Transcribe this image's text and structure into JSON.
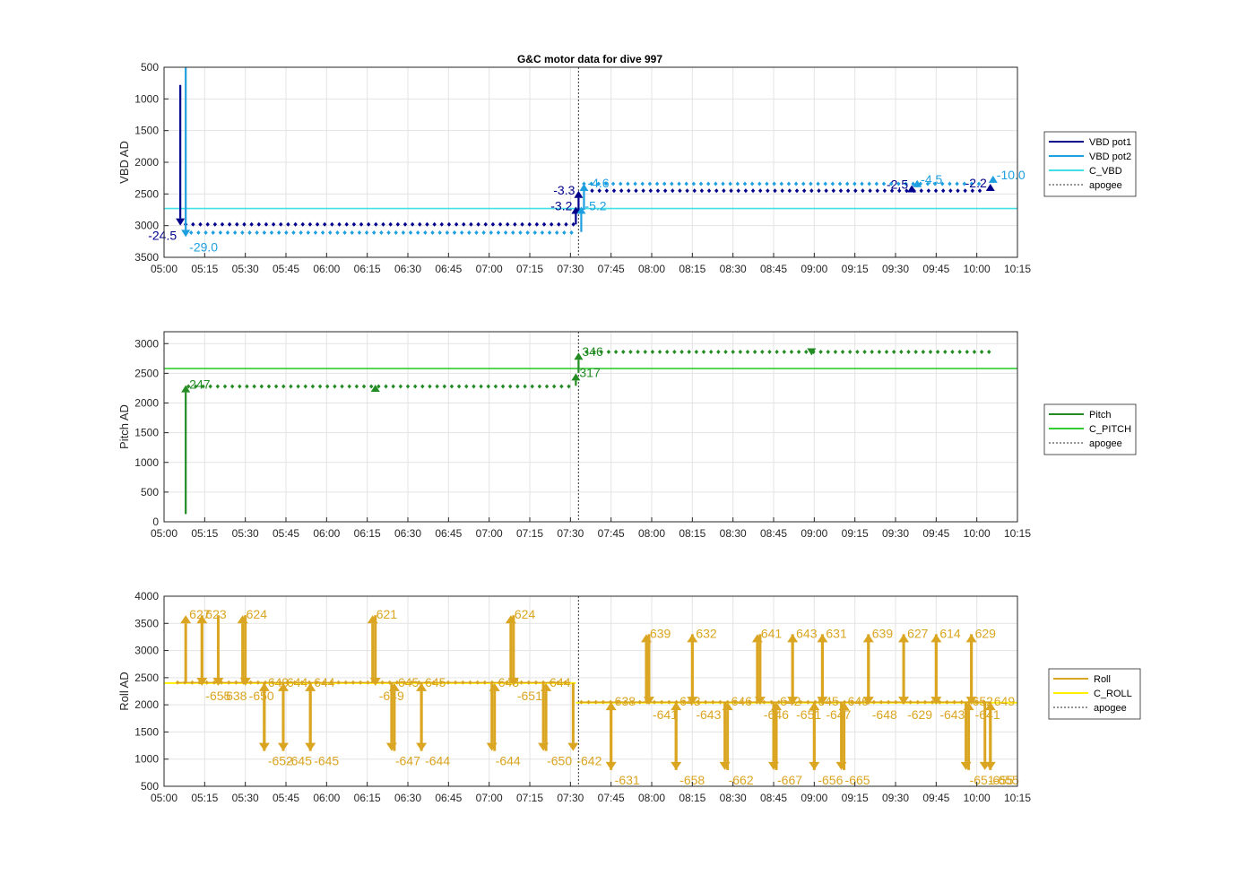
{
  "figure_title": "G&C motor data for dive 997",
  "x_ticks": [
    "05:00",
    "05:15",
    "05:30",
    "05:45",
    "06:00",
    "06:15",
    "06:30",
    "06:45",
    "07:00",
    "07:15",
    "07:30",
    "07:45",
    "08:00",
    "08:15",
    "08:30",
    "08:45",
    "09:00",
    "09:15",
    "09:30",
    "09:45",
    "10:00",
    "10:15"
  ],
  "colors": {
    "vbd_pot1": "#00008B",
    "vbd_pot2": "#1E9FE0",
    "c_vbd": "#40E0E6",
    "pitch": "#228B22",
    "c_pitch": "#32CD32",
    "roll": "#DAA520",
    "c_roll": "#FFF000",
    "apogee": "#555555"
  },
  "chart_data": [
    {
      "type": "line",
      "title": "G&C motor data for dive 997",
      "xlabel": "",
      "ylabel": "VBD AD",
      "x_unit": "HH:MM",
      "xlim": [
        "05:00",
        "10:15"
      ],
      "ylim": [
        3500,
        500
      ],
      "y_reversed": true,
      "yticks": [
        500,
        1000,
        1500,
        2000,
        2500,
        3000,
        3500
      ],
      "grid": true,
      "legend_position": "right",
      "legend": [
        "VBD pot1",
        "VBD pot2",
        "C_VBD",
        "apogee"
      ],
      "apogee": "07:33",
      "c_value": 2730,
      "series": [
        {
          "name": "VBD pot1",
          "color": "vbd_pot1",
          "samples": {
            "from": "05:08",
            "to": "07:32",
            "y": 2980
          },
          "samples2": {
            "from": "07:38",
            "to": "10:03",
            "y": 2450
          }
        },
        {
          "name": "VBD pot2",
          "color": "vbd_pot2",
          "samples": {
            "from": "05:10",
            "to": "07:32",
            "y": 3110
          },
          "samples2": {
            "from": "07:35",
            "to": "10:03",
            "y": 2340
          }
        }
      ],
      "annotations": [
        {
          "x": "05:06",
          "y0": 780,
          "y1": 3000,
          "dir": "down",
          "text": "-24.5",
          "color": "vbd_pot1",
          "side": "left"
        },
        {
          "x": "05:08",
          "y0": 500,
          "y1": 3180,
          "dir": "down",
          "text": "-29.0",
          "color": "vbd_pot2",
          "side": "right"
        },
        {
          "x": "07:32",
          "y0": 2980,
          "y1": 2700,
          "dir": "up",
          "text": "-3.2",
          "color": "vbd_pot1",
          "side": "left"
        },
        {
          "x": "07:33",
          "y0": 2780,
          "y1": 2450,
          "dir": "up",
          "text": "-3.3",
          "color": "vbd_pot1",
          "side": "left"
        },
        {
          "x": "07:34",
          "y0": 3100,
          "y1": 2700,
          "dir": "up",
          "text": "-5.2",
          "color": "vbd_pot2",
          "side": "right"
        },
        {
          "x": "07:35",
          "y0": 2750,
          "y1": 2340,
          "dir": "up",
          "text": "-4.6",
          "color": "vbd_pot2",
          "side": "right"
        },
        {
          "x": "09:36",
          "y0": 2450,
          "y1": 2360,
          "dir": "up",
          "text": "-2.5",
          "color": "vbd_pot1",
          "side": "left"
        },
        {
          "x": "09:38",
          "y0": 2350,
          "y1": 2280,
          "dir": "up",
          "text": "-4.5",
          "color": "vbd_pot2",
          "side": "right"
        },
        {
          "x": "10:05",
          "y0": 2420,
          "y1": 2340,
          "dir": "up",
          "text": "-2.2",
          "color": "vbd_pot1",
          "side": "left"
        },
        {
          "x": "10:06",
          "y0": 2300,
          "y1": 2210,
          "dir": "up",
          "text": "-10.0",
          "color": "vbd_pot2",
          "side": "right"
        }
      ]
    },
    {
      "type": "line",
      "title": "",
      "xlabel": "",
      "ylabel": "Pitch AD",
      "x_unit": "HH:MM",
      "xlim": [
        "05:00",
        "10:15"
      ],
      "ylim": [
        0,
        3200
      ],
      "yticks": [
        0,
        500,
        1000,
        1500,
        2000,
        2500,
        3000
      ],
      "grid": true,
      "legend_position": "right",
      "legend": [
        "Pitch",
        "C_PITCH",
        "apogee"
      ],
      "apogee": "07:33",
      "c_value": 2580,
      "series": [
        {
          "name": "Pitch",
          "color": "pitch",
          "samples": {
            "from": "05:09",
            "to": "07:30",
            "y": 2280
          },
          "samples2": {
            "from": "07:36",
            "to": "10:05",
            "y": 2860
          }
        }
      ],
      "annotations": [
        {
          "x": "05:08",
          "y0": 130,
          "y1": 2300,
          "dir": "up",
          "text": "247",
          "color": "pitch",
          "side": "right"
        },
        {
          "x": "06:18",
          "y0": 2260,
          "y1": 2310,
          "dir": "up",
          "text": "",
          "color": "pitch",
          "side": "right"
        },
        {
          "x": "07:32",
          "y0": 2290,
          "y1": 2500,
          "dir": "up",
          "text": "317",
          "color": "pitch",
          "side": "right"
        },
        {
          "x": "07:33",
          "y0": 2510,
          "y1": 2850,
          "dir": "up",
          "text": "346",
          "color": "pitch",
          "side": "right"
        },
        {
          "x": "08:59",
          "y0": 2880,
          "y1": 2800,
          "dir": "down",
          "text": "",
          "color": "pitch",
          "side": "right"
        }
      ]
    },
    {
      "type": "line",
      "title": "",
      "xlabel": "",
      "ylabel": "Roll AD",
      "x_unit": "HH:MM",
      "xlim": [
        "05:00",
        "10:15"
      ],
      "ylim": [
        500,
        4000
      ],
      "yticks": [
        500,
        1000,
        1500,
        2000,
        2500,
        3000,
        3500,
        4000
      ],
      "grid": true,
      "legend_position": "right",
      "legend": [
        "Roll",
        "C_ROLL",
        "apogee"
      ],
      "apogee": "07:33",
      "c_roll": [
        {
          "from": "05:00",
          "to": "07:32",
          "y": 2400
        },
        {
          "from": "07:32",
          "to": "10:15",
          "y": 2040
        }
      ],
      "series": [
        {
          "name": "Roll",
          "color": "roll",
          "samples": {
            "from": "05:05",
            "to": "07:30",
            "y": 2410
          },
          "samples2": {
            "from": "07:34",
            "to": "10:05",
            "y": 2050
          }
        }
      ],
      "annotations": [
        {
          "x": "05:08",
          "y0": 2400,
          "y1": 3650,
          "dir": "up",
          "text": "627",
          "color": "roll",
          "side": "right"
        },
        {
          "x": "05:14",
          "y0": 3650,
          "y1": 2350,
          "dir": "down",
          "text": "-655",
          "color": "roll",
          "side": "right"
        },
        {
          "x": "05:14",
          "y0": 2400,
          "y1": 3650,
          "dir": "up",
          "text": "623",
          "color": "roll",
          "side": "right"
        },
        {
          "x": "05:20",
          "y0": 3650,
          "y1": 2350,
          "dir": "down",
          "text": "-638",
          "color": "roll",
          "side": "right"
        },
        {
          "x": "05:29",
          "y0": 2400,
          "y1": 3650,
          "dir": "up",
          "text": "624",
          "color": "roll",
          "side": "right"
        },
        {
          "x": "05:30",
          "y0": 3650,
          "y1": 2350,
          "dir": "down",
          "text": "-650",
          "color": "roll",
          "side": "right"
        },
        {
          "x": "05:37",
          "y0": 2400,
          "y1": 1150,
          "dir": "down",
          "text": "-652",
          "color": "roll",
          "side": "right"
        },
        {
          "x": "05:37",
          "y0": 1150,
          "y1": 2400,
          "dir": "up",
          "text": "649",
          "color": "roll",
          "side": "right"
        },
        {
          "x": "05:44",
          "y0": 2400,
          "y1": 1150,
          "dir": "down",
          "text": "-645",
          "color": "roll",
          "side": "right"
        },
        {
          "x": "05:44",
          "y0": 1150,
          "y1": 2400,
          "dir": "up",
          "text": "644",
          "color": "roll",
          "side": "right"
        },
        {
          "x": "05:54",
          "y0": 2400,
          "y1": 1150,
          "dir": "down",
          "text": "-645",
          "color": "roll",
          "side": "right"
        },
        {
          "x": "05:54",
          "y0": 1150,
          "y1": 2400,
          "dir": "up",
          "text": "644",
          "color": "roll",
          "side": "right"
        },
        {
          "x": "06:17",
          "y0": 2400,
          "y1": 3650,
          "dir": "up",
          "text": "621",
          "color": "roll",
          "side": "right"
        },
        {
          "x": "06:18",
          "y0": 3650,
          "y1": 2350,
          "dir": "down",
          "text": "-649",
          "color": "roll",
          "side": "right"
        },
        {
          "x": "06:24",
          "y0": 2400,
          "y1": 1150,
          "dir": "down",
          "text": "-647",
          "color": "roll",
          "side": "right"
        },
        {
          "x": "06:25",
          "y0": 1150,
          "y1": 2400,
          "dir": "up",
          "text": "645",
          "color": "roll",
          "side": "right"
        },
        {
          "x": "06:35",
          "y0": 2400,
          "y1": 1150,
          "dir": "down",
          "text": "-644",
          "color": "roll",
          "side": "right"
        },
        {
          "x": "06:35",
          "y0": 1150,
          "y1": 2400,
          "dir": "up",
          "text": "645",
          "color": "roll",
          "side": "right"
        },
        {
          "x": "07:01",
          "y0": 2400,
          "y1": 1150,
          "dir": "down",
          "text": "-644",
          "color": "roll",
          "side": "right"
        },
        {
          "x": "07:02",
          "y0": 1150,
          "y1": 2400,
          "dir": "up",
          "text": "643",
          "color": "roll",
          "side": "right"
        },
        {
          "x": "07:08",
          "y0": 2400,
          "y1": 3650,
          "dir": "up",
          "text": "624",
          "color": "roll",
          "side": "right"
        },
        {
          "x": "07:09",
          "y0": 3650,
          "y1": 2350,
          "dir": "down",
          "text": "-651",
          "color": "roll",
          "side": "right"
        },
        {
          "x": "07:20",
          "y0": 2400,
          "y1": 1150,
          "dir": "down",
          "text": "-650",
          "color": "roll",
          "side": "right"
        },
        {
          "x": "07:21",
          "y0": 1150,
          "y1": 2400,
          "dir": "up",
          "text": "644",
          "color": "roll",
          "side": "right"
        },
        {
          "x": "07:31",
          "y0": 2400,
          "y1": 1150,
          "dir": "down",
          "text": "-642",
          "color": "roll",
          "side": "right"
        },
        {
          "x": "07:45",
          "y0": 2050,
          "y1": 800,
          "dir": "down",
          "text": "-631",
          "color": "roll",
          "side": "right"
        },
        {
          "x": "07:45",
          "y0": 800,
          "y1": 2050,
          "dir": "up",
          "text": "638",
          "color": "roll",
          "side": "right"
        },
        {
          "x": "07:58",
          "y0": 2050,
          "y1": 3300,
          "dir": "up",
          "text": "639",
          "color": "roll",
          "side": "right"
        },
        {
          "x": "07:59",
          "y0": 3300,
          "y1": 2000,
          "dir": "down",
          "text": "-641",
          "color": "roll",
          "side": "right"
        },
        {
          "x": "08:09",
          "y0": 2050,
          "y1": 800,
          "dir": "down",
          "text": "-658",
          "color": "roll",
          "side": "right"
        },
        {
          "x": "08:09",
          "y0": 800,
          "y1": 2050,
          "dir": "up",
          "text": "643",
          "color": "roll",
          "side": "right"
        },
        {
          "x": "08:15",
          "y0": 2050,
          "y1": 3300,
          "dir": "up",
          "text": "632",
          "color": "roll",
          "side": "right"
        },
        {
          "x": "08:15",
          "y0": 3300,
          "y1": 2000,
          "dir": "down",
          "text": "-643",
          "color": "roll",
          "side": "right"
        },
        {
          "x": "08:27",
          "y0": 2050,
          "y1": 800,
          "dir": "down",
          "text": "-662",
          "color": "roll",
          "side": "right"
        },
        {
          "x": "08:28",
          "y0": 800,
          "y1": 2050,
          "dir": "up",
          "text": "646",
          "color": "roll",
          "side": "right"
        },
        {
          "x": "08:39",
          "y0": 2050,
          "y1": 3300,
          "dir": "up",
          "text": "641",
          "color": "roll",
          "side": "right"
        },
        {
          "x": "08:40",
          "y0": 3300,
          "y1": 2000,
          "dir": "down",
          "text": "-646",
          "color": "roll",
          "side": "right"
        },
        {
          "x": "08:45",
          "y0": 2050,
          "y1": 800,
          "dir": "down",
          "text": "-667",
          "color": "roll",
          "side": "right"
        },
        {
          "x": "08:46",
          "y0": 800,
          "y1": 2050,
          "dir": "up",
          "text": "642",
          "color": "roll",
          "side": "right"
        },
        {
          "x": "08:52",
          "y0": 2050,
          "y1": 3300,
          "dir": "up",
          "text": "643",
          "color": "roll",
          "side": "right"
        },
        {
          "x": "08:52",
          "y0": 3300,
          "y1": 2000,
          "dir": "down",
          "text": "-651",
          "color": "roll",
          "side": "right"
        },
        {
          "x": "09:00",
          "y0": 2050,
          "y1": 800,
          "dir": "down",
          "text": "-656",
          "color": "roll",
          "side": "right"
        },
        {
          "x": "09:00",
          "y0": 800,
          "y1": 2050,
          "dir": "up",
          "text": "645",
          "color": "roll",
          "side": "right"
        },
        {
          "x": "09:03",
          "y0": 2050,
          "y1": 3300,
          "dir": "up",
          "text": "631",
          "color": "roll",
          "side": "right"
        },
        {
          "x": "09:03",
          "y0": 3300,
          "y1": 2000,
          "dir": "down",
          "text": "-647",
          "color": "roll",
          "side": "right"
        },
        {
          "x": "09:10",
          "y0": 2050,
          "y1": 800,
          "dir": "down",
          "text": "-665",
          "color": "roll",
          "side": "right"
        },
        {
          "x": "09:11",
          "y0": 800,
          "y1": 2050,
          "dir": "up",
          "text": "646",
          "color": "roll",
          "side": "right"
        },
        {
          "x": "09:20",
          "y0": 2050,
          "y1": 3300,
          "dir": "up",
          "text": "639",
          "color": "roll",
          "side": "right"
        },
        {
          "x": "09:20",
          "y0": 3300,
          "y1": 2000,
          "dir": "down",
          "text": "-648",
          "color": "roll",
          "side": "right"
        },
        {
          "x": "09:33",
          "y0": 2050,
          "y1": 3300,
          "dir": "up",
          "text": "627",
          "color": "roll",
          "side": "right"
        },
        {
          "x": "09:33",
          "y0": 3300,
          "y1": 2000,
          "dir": "down",
          "text": "-629",
          "color": "roll",
          "side": "right"
        },
        {
          "x": "09:45",
          "y0": 2050,
          "y1": 3300,
          "dir": "up",
          "text": "614",
          "color": "roll",
          "side": "right"
        },
        {
          "x": "09:45",
          "y0": 3300,
          "y1": 2000,
          "dir": "down",
          "text": "-643",
          "color": "roll",
          "side": "right"
        },
        {
          "x": "09:56",
          "y0": 2050,
          "y1": 800,
          "dir": "down",
          "text": "-651",
          "color": "roll",
          "side": "right"
        },
        {
          "x": "09:57",
          "y0": 800,
          "y1": 2050,
          "dir": "up",
          "text": "652",
          "color": "roll",
          "side": "right"
        },
        {
          "x": "09:58",
          "y0": 2050,
          "y1": 3300,
          "dir": "up",
          "text": "629",
          "color": "roll",
          "side": "right"
        },
        {
          "x": "09:58",
          "y0": 3300,
          "y1": 2000,
          "dir": "down",
          "text": "-641",
          "color": "roll",
          "side": "right"
        },
        {
          "x": "10:03",
          "y0": 2050,
          "y1": 800,
          "dir": "down",
          "text": "-655",
          "color": "roll",
          "side": "right"
        },
        {
          "x": "10:05",
          "y0": 800,
          "y1": 2050,
          "dir": "up",
          "text": "649",
          "color": "roll",
          "side": "right"
        },
        {
          "x": "10:05",
          "y0": 2050,
          "y1": 800,
          "dir": "down",
          "text": "-655",
          "color": "roll",
          "side": "right"
        }
      ]
    }
  ]
}
